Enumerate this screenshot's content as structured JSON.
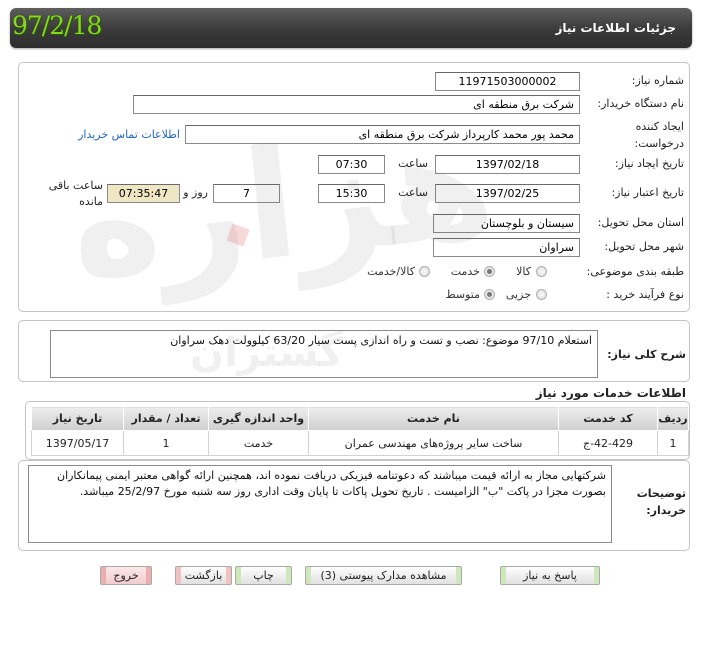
{
  "header": {
    "title": "جزئیات اطلاعات نیاز",
    "date_stamp": "97/2/18"
  },
  "colors": {
    "date_stamp": "#86d81c",
    "link": "#2466c2",
    "remaining_time_bg": "#efe7c4"
  },
  "form": {
    "need_number": {
      "label": "شماره نیاز:",
      "value": "11971503000002"
    },
    "buyer_org": {
      "label": "نام دستگاه خریدار:",
      "value": "شرکت برق منطقه ای"
    },
    "requester": {
      "label_line1": "ایجاد کننده",
      "label_line2": "درخواست:",
      "value": "محمد پور محمد کارپرداز شرکت برق منطقه ای",
      "contact_link": "اطلاعات تماس خریدار"
    },
    "created": {
      "label": "تاریخ ایجاد نیاز:",
      "date": "1397/02/18",
      "time_label": "ساعت",
      "time": "07:30"
    },
    "validity": {
      "label": "تاریخ اعتبار نیاز:",
      "date": "1397/02/25",
      "time_label": "ساعت",
      "time": "15:30",
      "days": "7",
      "days_label": "روز و",
      "remaining_time": "07:35:47",
      "remaining_label_line1": "ساعت باقی",
      "remaining_label_line2": "مانده"
    },
    "province": {
      "label": "استان محل تحویل:",
      "value": "سیستان و بلوچستان"
    },
    "city": {
      "label": "شهر محل تحویل:",
      "value": "سراوان"
    },
    "category": {
      "label": "طبقه بندی موضوعی:",
      "options": [
        {
          "label": "کالا",
          "selected": false
        },
        {
          "label": "خدمت",
          "selected": true
        },
        {
          "label": "کالا/خدمت",
          "selected": false
        }
      ]
    },
    "process": {
      "label": "نوع فرآیند خرید :",
      "options": [
        {
          "label": "جزیی",
          "selected": false
        },
        {
          "label": "متوسط",
          "selected": true
        }
      ]
    }
  },
  "description": {
    "label": "شرح کلی نیاز:",
    "text": "استعلام 97/10 موضوع: نصب و تست و راه اندازی پست سیار 63/20 کیلوولت دهک سراوان"
  },
  "services": {
    "heading": "اطلاعات خدمات مورد نیاز",
    "columns": [
      "ردیف",
      "کد خدمت",
      "نام خدمت",
      "واحد اندازه گیری",
      "تعداد / مقدار",
      "تاریخ نیاز"
    ],
    "rows": [
      [
        "1",
        "ج-42-429",
        "ساخت سایر پروژه‌های مهندسی عمران",
        "خدمت",
        "1",
        "1397/05/17"
      ]
    ]
  },
  "buyer_notes": {
    "label_line1": "توضیحات",
    "label_line2": "خریدار:",
    "text": "شرکتهایی مجاز به ارائه قیمت میباشند که دعوتنامه فیزیکی دریافت نموده اند، همچنین ارائه گواهی معتبر ایمنی پیمانکاران بصورت مجزا در پاکت \"ب\" الزامیست . تاریخ تحویل پاکات تا پایان وقت اداری روز سه شنبه مورخ 25/2/97 میباشد."
  },
  "buttons": {
    "reply": "پاسخ به نیاز",
    "attachments": "مشاهده مدارک پیوستی (3)",
    "print": "چاپ",
    "back": "بازگشت",
    "exit": "خروج"
  },
  "watermark": {
    "line1": "هزاره",
    "line2": "گستران"
  }
}
